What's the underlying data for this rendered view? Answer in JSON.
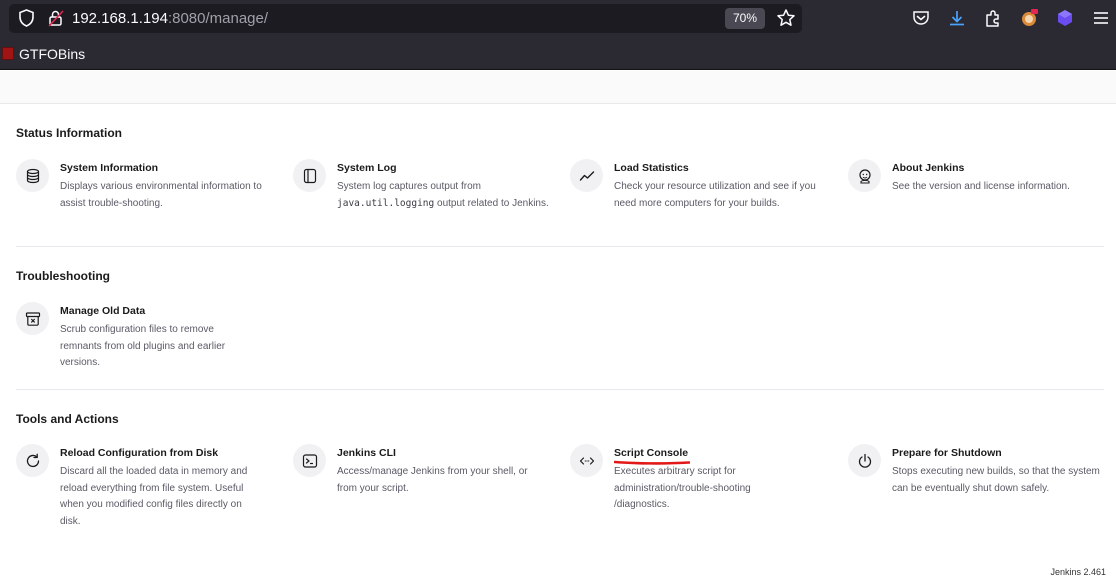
{
  "browser": {
    "url_host": "192.168.1.194",
    "url_rest": ":8080/manage/",
    "zoom": "70%",
    "bookmark": "GTFOBins"
  },
  "sections": {
    "status": {
      "title": "Status Information",
      "items": [
        {
          "name": "System Information",
          "desc": "Displays various environmental information to assist trouble-shooting.",
          "icon": "database-icon"
        },
        {
          "name": "System Log",
          "desc_pre": "System log captures output from ",
          "desc_code": "java.util.logging",
          "desc_post": " output related to Jenkins.",
          "icon": "log-icon"
        },
        {
          "name": "Load Statistics",
          "desc": "Check your resource utilization and see if you need more computers for your builds.",
          "icon": "chart-line-icon"
        },
        {
          "name": "About Jenkins",
          "desc": "See the version and license information.",
          "icon": "jenkins-head-icon"
        }
      ]
    },
    "troubleshooting": {
      "title": "Troubleshooting",
      "items": [
        {
          "name": "Manage Old Data",
          "desc": "Scrub configuration files to remove remnants from old plugins and earlier versions.",
          "icon": "archive-icon"
        }
      ]
    },
    "tools": {
      "title": "Tools and Actions",
      "items": [
        {
          "name": "Reload Configuration from Disk",
          "desc": "Discard all the loaded data in memory and reload everything from file system. Useful when you modified config files directly on disk.",
          "icon": "reload-icon"
        },
        {
          "name": "Jenkins CLI",
          "desc": "Access/manage Jenkins from your shell, or from your script.",
          "icon": "terminal-icon"
        },
        {
          "name": "Script Console",
          "desc": "Executes arbitrary script for administration/trouble-shooting /diagnostics.",
          "icon": "code-icon"
        },
        {
          "name": "Prepare for Shutdown",
          "desc": "Stops executing new builds, so that the system can be eventually shut down safely.",
          "icon": "power-icon"
        }
      ]
    }
  },
  "footer": {
    "version": "Jenkins 2.461"
  }
}
